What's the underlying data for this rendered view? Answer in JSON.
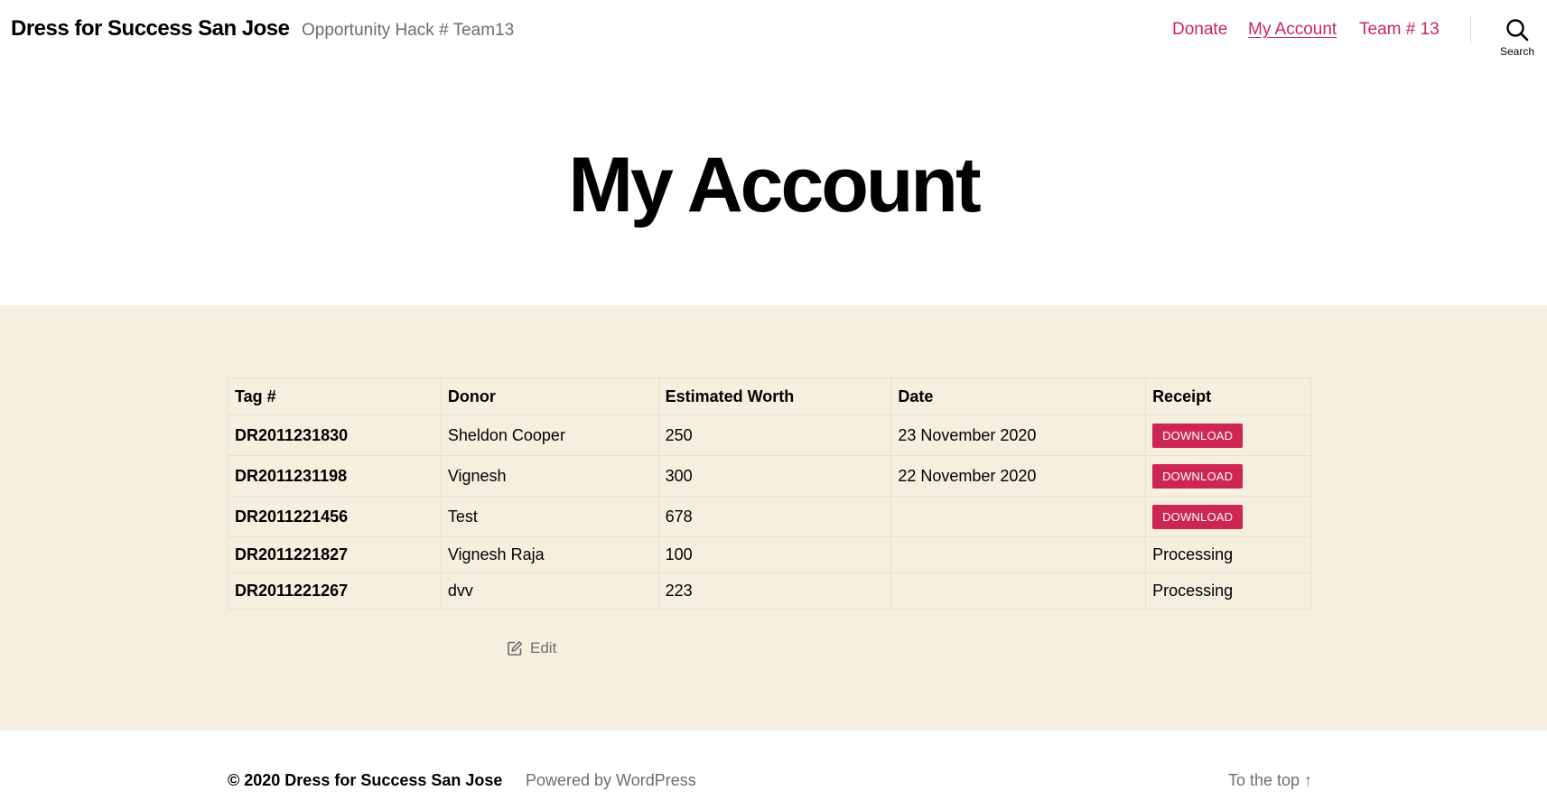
{
  "header": {
    "site_title": "Dress for Success San Jose",
    "site_description": "Opportunity Hack # Team13",
    "nav": [
      {
        "label": "Donate",
        "current": false
      },
      {
        "label": "My Account",
        "current": true
      },
      {
        "label": "Team # 13",
        "current": false
      }
    ],
    "search_label": "Search"
  },
  "page": {
    "title": "My Account"
  },
  "table": {
    "columns": [
      "Tag #",
      "Donor",
      "Estimated Worth",
      "Date",
      "Receipt"
    ],
    "rows": [
      {
        "tag": "DR2011231830",
        "donor": "Sheldon Cooper",
        "worth": "250",
        "date": "23 November 2020",
        "receipt": "DOWNLOAD",
        "receipt_type": "button"
      },
      {
        "tag": "DR2011231198",
        "donor": "Vignesh",
        "worth": "300",
        "date": "22 November 2020",
        "receipt": "DOWNLOAD",
        "receipt_type": "button"
      },
      {
        "tag": "DR2011221456",
        "donor": "Test",
        "worth": "678",
        "date": "",
        "receipt": "DOWNLOAD",
        "receipt_type": "button"
      },
      {
        "tag": "DR2011221827",
        "donor": "Vignesh Raja",
        "worth": "100",
        "date": "",
        "receipt": "Processing",
        "receipt_type": "text"
      },
      {
        "tag": "DR2011221267",
        "donor": "dvv",
        "worth": "223",
        "date": "",
        "receipt": "Processing",
        "receipt_type": "text"
      }
    ]
  },
  "edit_label": "Edit",
  "footer": {
    "copyright": "© 2020 Dress for Success San Jose",
    "powered_by": "Powered by WordPress",
    "to_top": "To the top ↑"
  },
  "colors": {
    "accent": "#cd2653",
    "band_background": "#f5efe0",
    "muted_text": "#6d6d6d"
  }
}
